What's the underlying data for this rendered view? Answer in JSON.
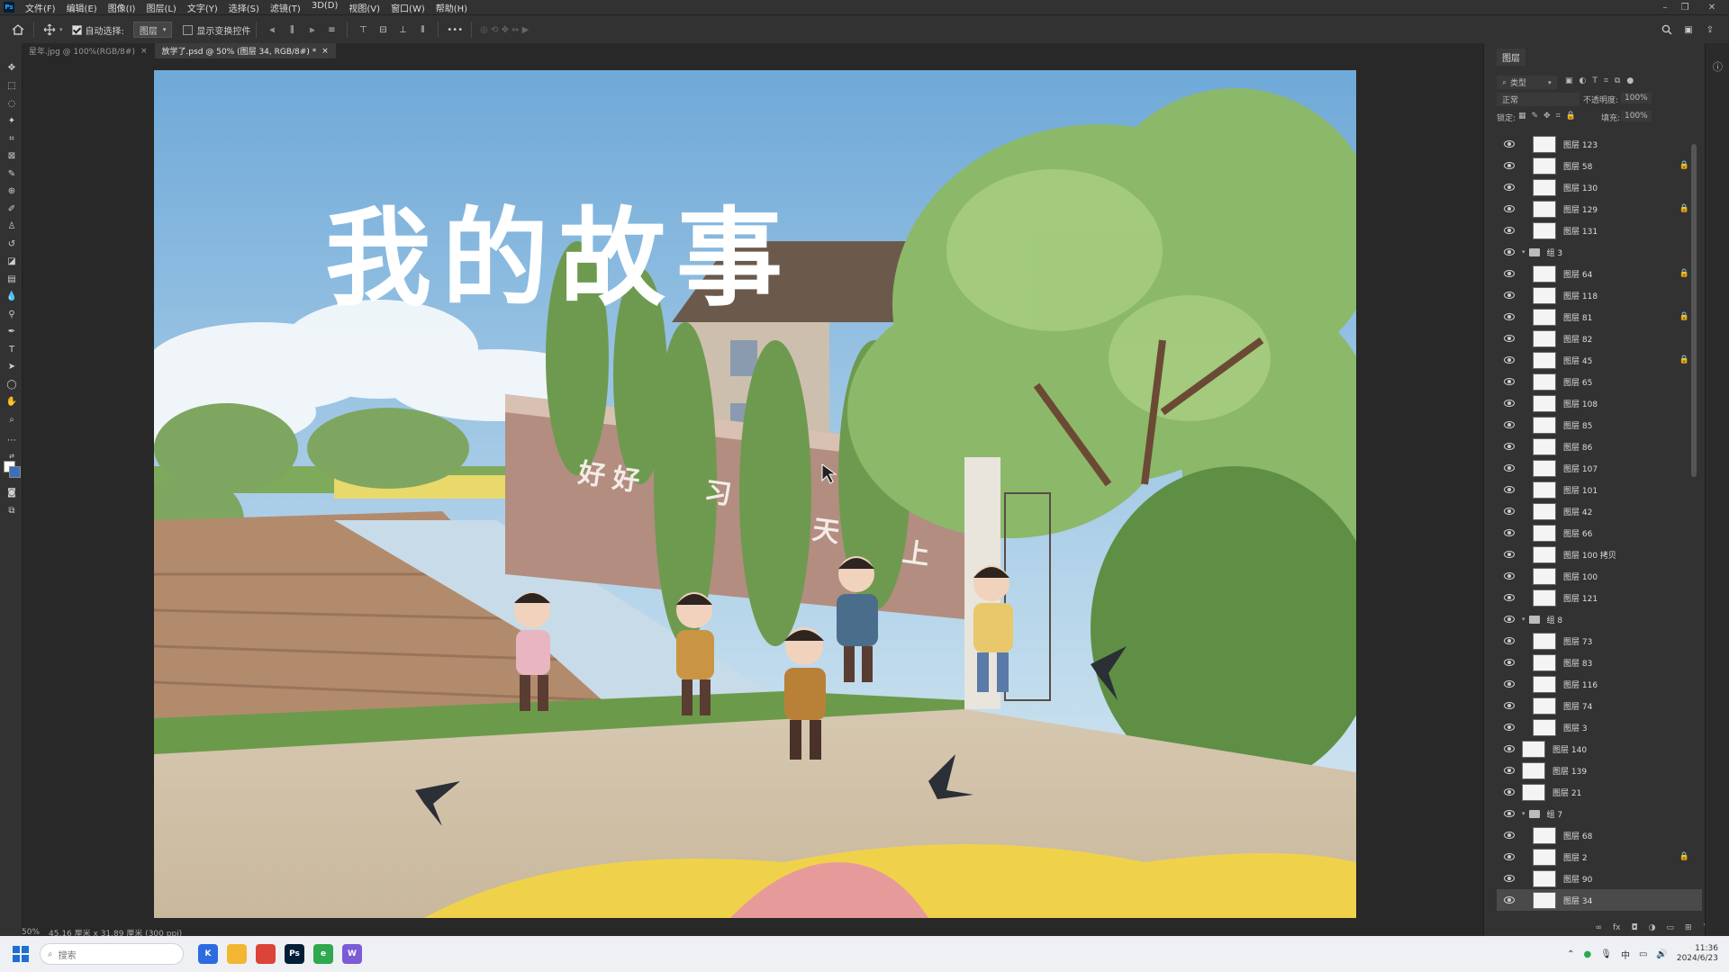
{
  "menubar": {
    "items": [
      "文件(F)",
      "编辑(E)",
      "图像(I)",
      "图层(L)",
      "文字(Y)",
      "选择(S)",
      "滤镜(T)",
      "3D(D)",
      "视图(V)",
      "窗口(W)",
      "帮助(H)"
    ]
  },
  "options": {
    "auto_select_label": "自动选择:",
    "auto_select_checked": true,
    "target_value": "图层",
    "transform_label": "显示变换控件",
    "more_label": "•••"
  },
  "tabs": [
    {
      "label": "星年.jpg @ 100%(RGB/8#)",
      "active": false
    },
    {
      "label": "放学了.psd @ 50% (图层 34, RGB/8#) *",
      "active": true
    }
  ],
  "artwork": {
    "title": "我的故事",
    "wall_text": [
      "好",
      "好",
      "习",
      "天",
      "上"
    ]
  },
  "status": {
    "zoom": "50%",
    "doc_info": "45.16 厘米 x 31.89 厘米 (300 ppi)"
  },
  "layers_panel": {
    "tab_label": "图层",
    "filter_label": "类型",
    "blend_mode": "正常",
    "opacity_label": "不透明度:",
    "opacity_value": "100%",
    "lock_label": "锁定:",
    "fill_label": "填充:",
    "fill_value": "100%",
    "rows": [
      {
        "kind": "layer",
        "name": "图层 123",
        "indent": 1,
        "locked": false
      },
      {
        "kind": "layer",
        "name": "图层 58",
        "indent": 1,
        "locked": true
      },
      {
        "kind": "layer",
        "name": "图层 130",
        "indent": 1,
        "locked": false
      },
      {
        "kind": "layer",
        "name": "图层 129",
        "indent": 1,
        "locked": true
      },
      {
        "kind": "layer",
        "name": "图层 131",
        "indent": 1,
        "locked": false
      },
      {
        "kind": "group",
        "name": "组 3",
        "indent": 0,
        "locked": false
      },
      {
        "kind": "layer",
        "name": "图层 64",
        "indent": 1,
        "locked": true
      },
      {
        "kind": "layer",
        "name": "图层 118",
        "indent": 1,
        "locked": false
      },
      {
        "kind": "layer",
        "name": "图层 81",
        "indent": 1,
        "locked": true
      },
      {
        "kind": "layer",
        "name": "图层 82",
        "indent": 1,
        "locked": false
      },
      {
        "kind": "layer",
        "name": "图层 45",
        "indent": 1,
        "locked": true
      },
      {
        "kind": "layer",
        "name": "图层 65",
        "indent": 1,
        "locked": false
      },
      {
        "kind": "layer",
        "name": "图层 108",
        "indent": 1,
        "locked": false
      },
      {
        "kind": "layer",
        "name": "图层 85",
        "indent": 1,
        "locked": false
      },
      {
        "kind": "layer",
        "name": "图层 86",
        "indent": 1,
        "locked": false
      },
      {
        "kind": "layer",
        "name": "图层 107",
        "indent": 1,
        "locked": false
      },
      {
        "kind": "layer",
        "name": "图层 101",
        "indent": 1,
        "locked": false
      },
      {
        "kind": "layer",
        "name": "图层 42",
        "indent": 1,
        "locked": false
      },
      {
        "kind": "layer",
        "name": "图层 66",
        "indent": 1,
        "locked": false
      },
      {
        "kind": "layer",
        "name": "图层 100 拷贝",
        "indent": 1,
        "locked": false
      },
      {
        "kind": "layer",
        "name": "图层 100",
        "indent": 1,
        "locked": false
      },
      {
        "kind": "layer",
        "name": "图层 121",
        "indent": 1,
        "locked": false
      },
      {
        "kind": "group",
        "name": "组 8",
        "indent": 0,
        "locked": false
      },
      {
        "kind": "layer",
        "name": "图层 73",
        "indent": 1,
        "locked": false
      },
      {
        "kind": "layer",
        "name": "图层 83",
        "indent": 1,
        "locked": false
      },
      {
        "kind": "layer",
        "name": "图层 116",
        "indent": 1,
        "locked": false
      },
      {
        "kind": "layer",
        "name": "图层 74",
        "indent": 1,
        "locked": false
      },
      {
        "kind": "layer",
        "name": "图层 3",
        "indent": 1,
        "locked": false
      },
      {
        "kind": "layer",
        "name": "图层 140",
        "indent": 0,
        "locked": false
      },
      {
        "kind": "layer",
        "name": "图层 139",
        "indent": 0,
        "locked": false
      },
      {
        "kind": "layer",
        "name": "图层 21",
        "indent": 0,
        "locked": false
      },
      {
        "kind": "group",
        "name": "组 7",
        "indent": 0,
        "locked": false
      },
      {
        "kind": "layer",
        "name": "图层 68",
        "indent": 1,
        "locked": false
      },
      {
        "kind": "layer",
        "name": "图层 2",
        "indent": 1,
        "locked": true
      },
      {
        "kind": "layer",
        "name": "图层 90",
        "indent": 1,
        "locked": false
      },
      {
        "kind": "layer",
        "name": "图层 34",
        "indent": 1,
        "locked": false,
        "selected": true
      }
    ]
  },
  "taskbar": {
    "search_placeholder": "搜索",
    "apps": [
      {
        "icon": "k-app-icon",
        "label": "K",
        "color": "#2d6be0"
      },
      {
        "icon": "folder-icon",
        "label": "",
        "color": "#f2b632"
      },
      {
        "icon": "chrome-icon",
        "label": "",
        "color": "#db4437"
      },
      {
        "icon": "photoshop-icon",
        "label": "Ps",
        "color": "#001e36"
      },
      {
        "icon": "green-app-icon",
        "label": "e",
        "color": "#2fa84f"
      },
      {
        "icon": "w-app-icon",
        "label": "W",
        "color": "#7b5cd6"
      }
    ],
    "tray_lang": "中",
    "time": "11:36",
    "date": "2024/6/23"
  }
}
